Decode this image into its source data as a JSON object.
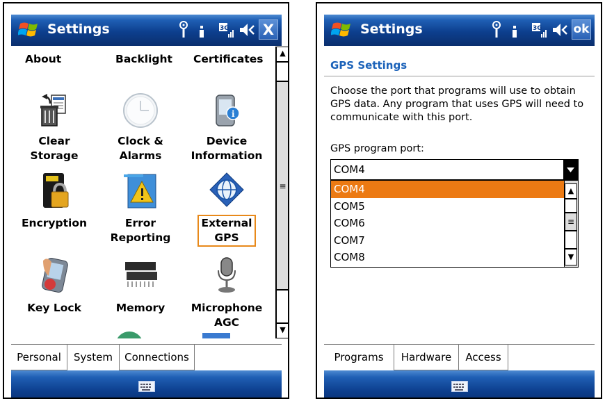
{
  "left": {
    "title": "Settings",
    "close_label": "X",
    "top_labels": [
      "About",
      "Backlight",
      "Certificates"
    ],
    "items": [
      {
        "line1": "Clear",
        "line2": "Storage",
        "icon": "clear-storage-icon"
      },
      {
        "line1": "Clock &",
        "line2": "Alarms",
        "icon": "clock-icon"
      },
      {
        "line1": "Device",
        "line2": "Information",
        "icon": "device-info-icon"
      },
      {
        "line1": "Encryption",
        "line2": "",
        "icon": "encryption-icon"
      },
      {
        "line1": "Error",
        "line2": "Reporting",
        "icon": "error-reporting-icon"
      },
      {
        "line1": "External",
        "line2": "GPS",
        "icon": "external-gps-icon"
      },
      {
        "line1": "Key Lock",
        "line2": "",
        "icon": "key-lock-icon"
      },
      {
        "line1": "Memory",
        "line2": "",
        "icon": "memory-icon"
      },
      {
        "line1": "Microphone",
        "line2": "AGC",
        "icon": "microphone-icon"
      }
    ],
    "tabs": [
      "Personal",
      "System",
      "Connections"
    ],
    "active_tab": "System"
  },
  "right": {
    "title": "Settings",
    "ok_label": "ok",
    "heading": "GPS Settings",
    "description": "Choose the port that programs will use to obtain GPS data. Any program that uses GPS will need to communicate with this port.",
    "port_label": "GPS program port:",
    "port_value": "COM4",
    "port_options": [
      "COM4",
      "COM5",
      "COM6",
      "COM7",
      "COM8"
    ],
    "tabs": [
      "Programs",
      "Hardware",
      "Access"
    ],
    "active_tab": "Programs"
  },
  "colors": {
    "titlebar": "#0d3f8e",
    "heading": "#1b62b9",
    "selection": "#ec7a13",
    "focus_box": "#e8891a"
  }
}
